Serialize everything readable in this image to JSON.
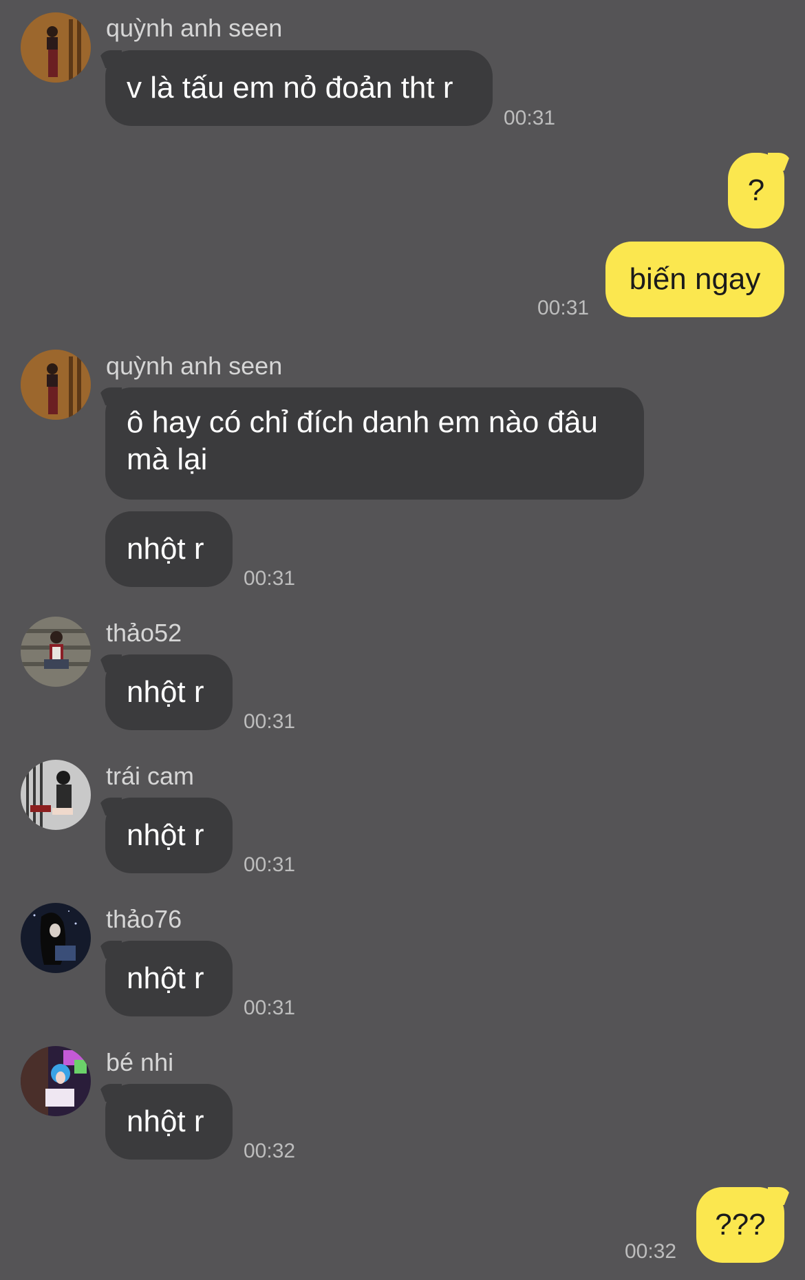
{
  "messages": [
    {
      "sender": "quỳnh anh seen",
      "text": "v là tấu em nỏ đoản tht r",
      "time": "00:31"
    },
    {
      "text": "?"
    },
    {
      "text": "biến ngay",
      "time": "00:31"
    },
    {
      "sender": "quỳnh anh seen",
      "text_lines": [
        "ô hay có chỉ đích danh em nào đâu",
        "mà lại"
      ]
    },
    {
      "text": "nhột r",
      "time": "00:31"
    },
    {
      "sender": "thảo52",
      "text": "nhột r",
      "time": "00:31"
    },
    {
      "sender": "trái cam",
      "text": "nhột r",
      "time": "00:31"
    },
    {
      "sender": "thảo76",
      "text": "nhột r",
      "time": "00:31"
    },
    {
      "sender": "bé nhi",
      "text": "nhột r",
      "time": "00:32"
    },
    {
      "text": "???",
      "time": "00:32"
    }
  ],
  "colors": {
    "background": "#555456",
    "incoming_bubble": "#3b3b3d",
    "outgoing_bubble": "#fbe74f"
  }
}
